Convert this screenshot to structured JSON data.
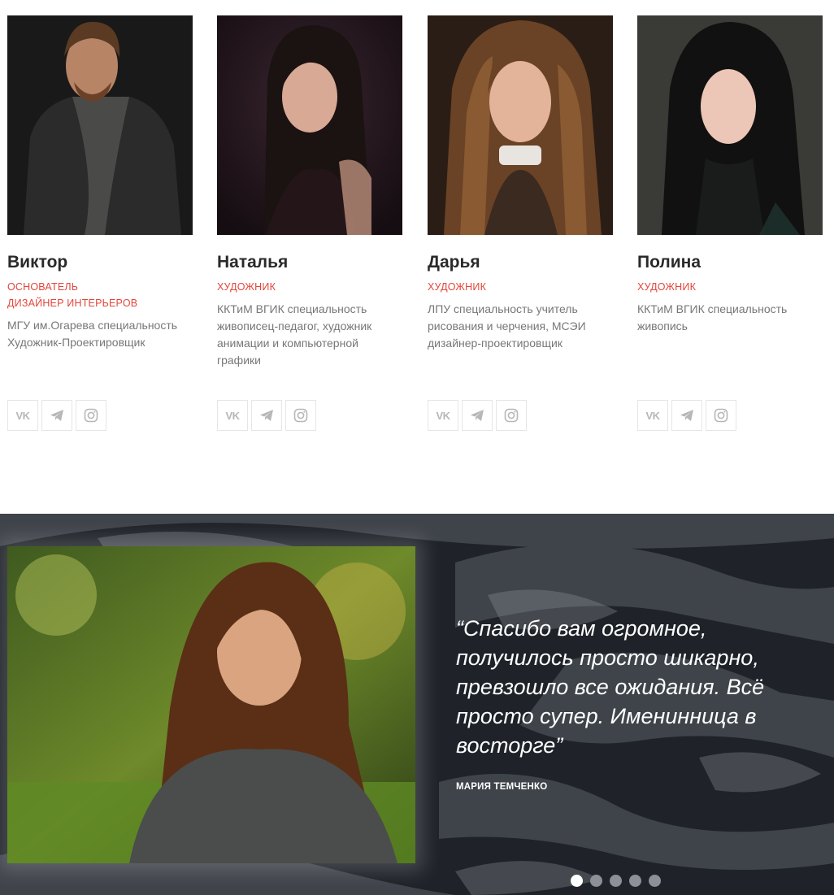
{
  "team": [
    {
      "name": "Виктор",
      "roles": [
        "ОСНОВАТЕЛЬ",
        "ДИЗАЙНЕР ИНТЕРЬЕРОВ"
      ],
      "bio": "МГУ им.Огарева специальность Художник-Проектировщик",
      "photo_colors": [
        "#1a1a1a",
        "#2b2622",
        "#b78466"
      ]
    },
    {
      "name": "Наталья",
      "roles": [
        "ХУДОЖНИК"
      ],
      "bio": "ККТиМ ВГИК специальность живописец-педагог, художник анимации и компьютерной графики",
      "photo_colors": [
        "#2a1a22",
        "#1b1416",
        "#d8a994"
      ]
    },
    {
      "name": "Дарья",
      "roles": [
        "ХУДОЖНИК"
      ],
      "bio": "ЛПУ специальность учитель рисования и черчения, МСЭИ дизайнер-проектировщик",
      "photo_colors": [
        "#2e2118",
        "#6a4225",
        "#e4b49a"
      ]
    },
    {
      "name": "Полина",
      "roles": [
        "ХУДОЖНИК"
      ],
      "bio": "ККТиМ ВГИК специальность живопись",
      "photo_colors": [
        "#3a3a36",
        "#111111",
        "#ecc6b7"
      ]
    }
  ],
  "social_icons": [
    "vk-icon",
    "telegram-icon",
    "instagram-icon"
  ],
  "social_vk_label": "VK",
  "testimonial": {
    "quote": "“Спасибо вам огромное, получилось просто шикарно, превзошло все ожидания. Всё просто супер. Именинница в восторге”",
    "author": "МАРИЯ ТЕМЧЕНКО",
    "dots_count": 5,
    "active_dot": 1
  },
  "colors": {
    "accent": "#e2463b",
    "dark_bg": "#1f2329"
  }
}
